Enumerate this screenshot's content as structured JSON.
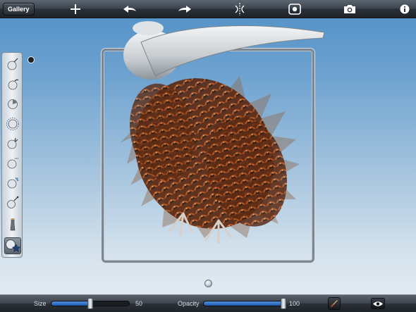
{
  "toolbar": {
    "gallery_label": "Gallery",
    "icons": [
      "add-icon",
      "undo-icon",
      "redo-icon",
      "symmetry-icon",
      "camera-reset-icon",
      "snapshot-camera-icon",
      "info-icon"
    ]
  },
  "palette": {
    "tools": [
      "draw-tool",
      "smooth-tool",
      "grab-tool",
      "inflate-tool",
      "pinch-tool",
      "flatten-tool",
      "scrape-tool",
      "wax-tool",
      "brush-stamp-tool",
      "paint-tool"
    ],
    "active_tool": "paint-tool"
  },
  "bottom": {
    "size_label": "Size",
    "size_value": "50",
    "size_fraction": 0.5,
    "opacity_label": "Opacity",
    "opacity_value": "100",
    "opacity_fraction": 1.0
  },
  "colors": {
    "accent": "#2a6cc4",
    "background_top": "#4f8fc6",
    "background_bottom": "#e7eef3"
  }
}
